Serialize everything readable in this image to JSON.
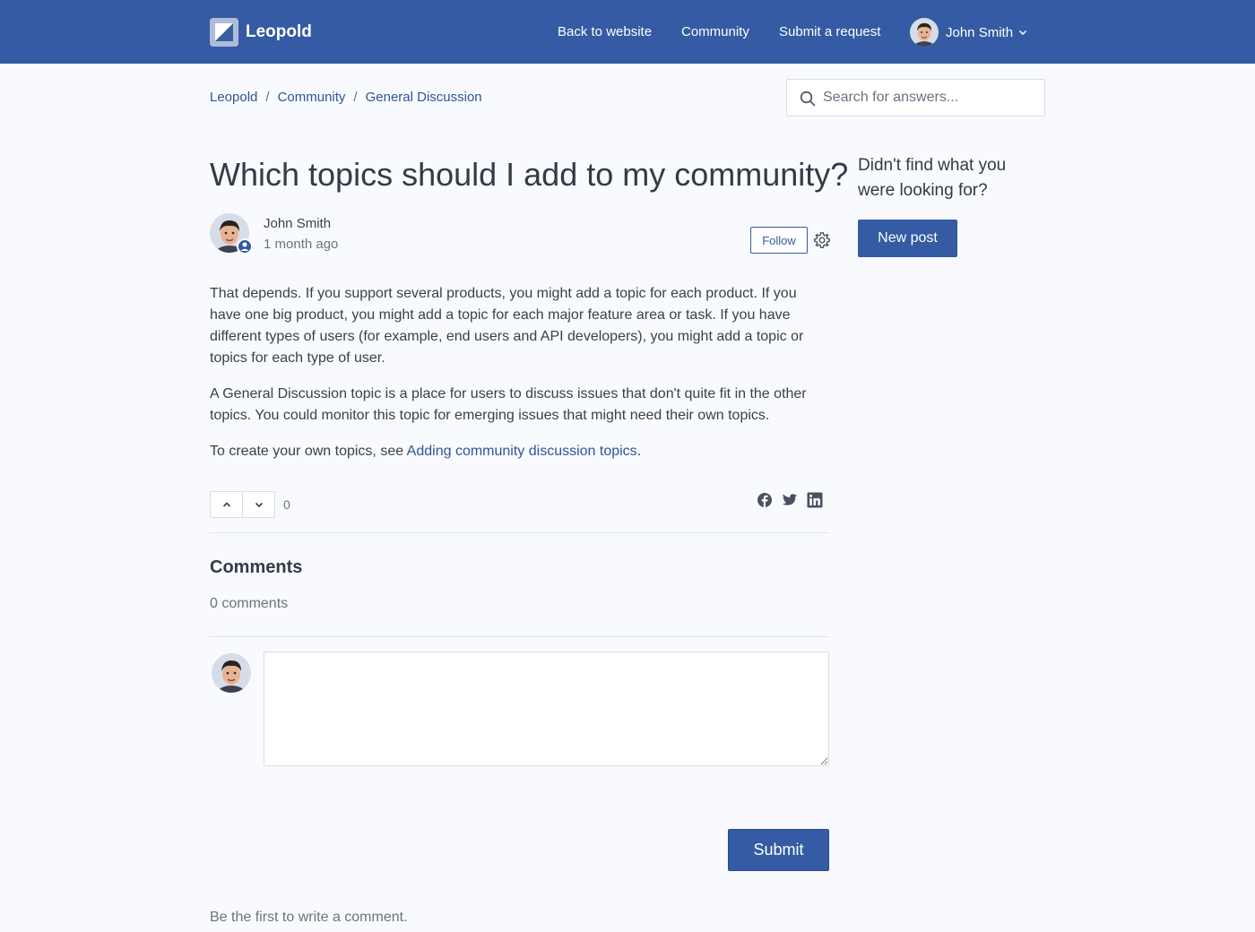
{
  "header": {
    "brand": "Leopold",
    "nav": [
      "Back to website",
      "Community",
      "Submit a request"
    ],
    "user_name": "John Smith"
  },
  "breadcrumb": [
    "Leopold",
    "Community",
    "General Discussion"
  ],
  "search": {
    "placeholder": "Search for answers..."
  },
  "post": {
    "title": "Which topics should I add to my community?",
    "author": "John Smith",
    "time": "1 month ago",
    "follow_label": "Follow",
    "paragraphs": [
      "That depends. If you support several products, you might add a topic for each product. If you have one big product, you might add a topic for each major feature area or task. If you have different types of users (for example, end users and API developers), you might add a topic or topics for each type of user.",
      "A General Discussion topic is a place for users to discuss issues that don't quite fit in the other topics. You could monitor this topic for emerging issues that might need their own topics."
    ],
    "link_prefix": "To create your own topics, see ",
    "link_text": "Adding community discussion topics",
    "link_suffix": ".",
    "vote_count": "0",
    "share_icons": [
      "facebook-icon",
      "twitter-icon",
      "linkedin-icon"
    ]
  },
  "comments": {
    "title": "Comments",
    "count_label": "0 comments",
    "submit_label": "Submit",
    "empty_message": "Be the first to write a comment."
  },
  "sidebar": {
    "heading": "Didn't find what you were looking for?",
    "new_post_label": "New post"
  },
  "colors": {
    "brand": "#345ba3",
    "link": "#2f5596",
    "background": "#f8fafd"
  }
}
